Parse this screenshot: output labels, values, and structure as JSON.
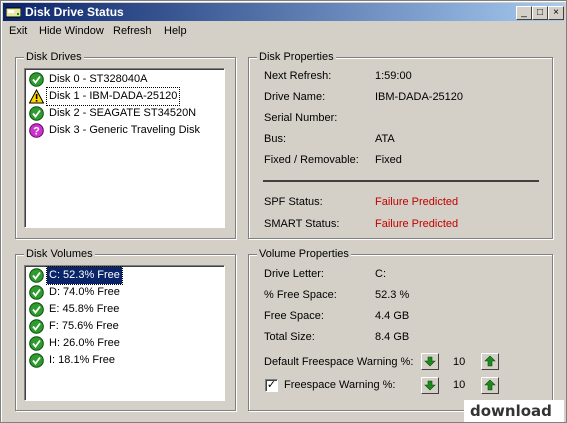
{
  "window": {
    "title": "Disk Drive Status"
  },
  "menu": [
    {
      "label": "Exit",
      "key": "x"
    },
    {
      "label": "Hide Window",
      "key": "H"
    },
    {
      "label": "Refresh",
      "key": "R"
    },
    {
      "label": "Help",
      "key": "H"
    }
  ],
  "disk_drives": {
    "title": "Disk Drives",
    "items": [
      {
        "label": "Disk 0 - ST328040A",
        "status": "ok",
        "icon": "green-check-icon"
      },
      {
        "label": "Disk 1 - IBM-DADA-25120",
        "status": "warning",
        "icon": "warning-icon",
        "selected": true
      },
      {
        "label": "Disk 2 - SEAGATE ST34520N",
        "status": "ok",
        "icon": "green-check-icon"
      },
      {
        "label": "Disk 3 - Generic Traveling Disk",
        "status": "unknown",
        "icon": "question-icon"
      }
    ]
  },
  "disk_properties": {
    "title": "Disk Properties",
    "rows": [
      {
        "label": "Next Refresh:",
        "value": "1:59:00"
      },
      {
        "label": "Drive Name:",
        "value": "IBM-DADA-25120"
      },
      {
        "label": "Serial Number:",
        "value": ""
      },
      {
        "label": "Bus:",
        "value": "ATA"
      },
      {
        "label": "Fixed / Removable:",
        "value": "Fixed"
      }
    ],
    "spf_label": "SPF Status:",
    "spf_value": "Failure Predicted",
    "smart_label": "SMART Status:",
    "smart_value": "Failure Predicted"
  },
  "disk_volumes": {
    "title": "Disk Volumes",
    "items": [
      {
        "label": "C: 52.3% Free",
        "selected": true
      },
      {
        "label": "D: 74.0% Free"
      },
      {
        "label": "E: 45.8% Free"
      },
      {
        "label": "F: 75.6% Free"
      },
      {
        "label": "H: 26.0% Free"
      },
      {
        "label": "I: 18.1% Free"
      }
    ]
  },
  "volume_properties": {
    "title": "Volume Properties",
    "rows": [
      {
        "label": "Drive Letter:",
        "value": "C:"
      },
      {
        "label": "% Free Space:",
        "value": "52.3 %"
      },
      {
        "label": "Free Space:",
        "value": "4.4 GB"
      },
      {
        "label": "Total Size:",
        "value": "8.4 GB"
      }
    ],
    "default_warning_label": "Default Freespace Warning %:",
    "default_warning_value": "10",
    "warning_label": "Freespace Warning %:",
    "warning_value": "10",
    "warning_checked": true
  },
  "watermark": "download",
  "colors": {
    "accent": "#0a246a",
    "failure": "#c00000",
    "ok_green": "#2e8b2e"
  }
}
